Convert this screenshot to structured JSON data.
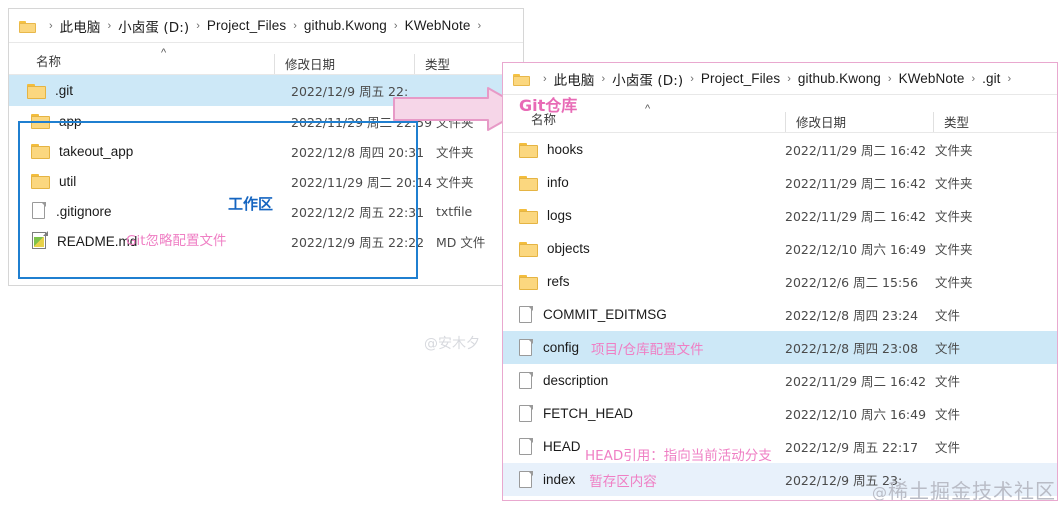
{
  "left_window": {
    "name": "working-directory-explorer",
    "breadcrumb": {
      "folder_icon": "folder-icon",
      "items": [
        "此电脑",
        "小卤蛋 (D:)",
        "Project_Files",
        "github.Kwong",
        "KWebNote"
      ],
      "separator": "›",
      "trailing_separator": "›"
    },
    "columns": [
      "名称",
      "修改日期",
      "类型"
    ],
    "sort_indicator": "^",
    "rows": [
      {
        "icon": "folder-icon",
        "name": ".git",
        "date": "2022/12/9 周五 22:",
        "type": "",
        "state": "selected"
      },
      {
        "icon": "folder-icon",
        "name": "app",
        "date": "2022/11/29 周二 22:59",
        "type": "文件夹",
        "state": "normal"
      },
      {
        "icon": "folder-icon",
        "name": "takeout_app",
        "date": "2022/12/8 周四 20:31",
        "type": "文件夹",
        "state": "normal"
      },
      {
        "icon": "folder-icon",
        "name": "util",
        "date": "2022/11/29 周二 20:14",
        "type": "文件夹",
        "state": "normal"
      },
      {
        "icon": "file-icon",
        "name": ".gitignore",
        "date": "2022/12/2 周五 22:31",
        "type": "txtfile",
        "state": "normal"
      },
      {
        "icon": "markdown-file-icon",
        "name": "README.md",
        "date": "2022/12/9 周五 22:22",
        "type": "MD 文件",
        "state": "normal"
      }
    ],
    "annotations": {
      "workspace": "工作区",
      "gitignore": "Git忽略配置文件"
    }
  },
  "right_window": {
    "name": "git-repository-explorer",
    "breadcrumb": {
      "folder_icon": "folder-icon",
      "items": [
        "此电脑",
        "小卤蛋 (D:)",
        "Project_Files",
        "github.Kwong",
        "KWebNote",
        ".git"
      ],
      "separator": "›",
      "trailing_separator": "›"
    },
    "columns": [
      "名称",
      "修改日期",
      "类型"
    ],
    "sort_indicator": "^",
    "title_annotation": "Git仓库",
    "rows": [
      {
        "icon": "folder-icon",
        "name": "hooks",
        "date": "2022/11/29 周二 16:42",
        "type": "文件夹",
        "state": "normal",
        "note": ""
      },
      {
        "icon": "folder-icon",
        "name": "info",
        "date": "2022/11/29 周二 16:42",
        "type": "文件夹",
        "state": "normal",
        "note": ""
      },
      {
        "icon": "folder-icon",
        "name": "logs",
        "date": "2022/11/29 周二 16:42",
        "type": "文件夹",
        "state": "normal",
        "note": ""
      },
      {
        "icon": "folder-icon",
        "name": "objects",
        "date": "2022/12/10 周六 16:49",
        "type": "文件夹",
        "state": "normal",
        "note": ""
      },
      {
        "icon": "folder-icon",
        "name": "refs",
        "date": "2022/12/6 周二 15:56",
        "type": "文件夹",
        "state": "normal",
        "note": ""
      },
      {
        "icon": "file-icon",
        "name": "COMMIT_EDITMSG",
        "date": "2022/12/8 周四 23:24",
        "type": "文件",
        "state": "normal",
        "note": ""
      },
      {
        "icon": "file-icon",
        "name": "config",
        "date": "2022/12/8 周四 23:08",
        "type": "文件",
        "state": "selected",
        "note": "项目/仓库配置文件"
      },
      {
        "icon": "file-icon",
        "name": "description",
        "date": "2022/11/29 周二 16:42",
        "type": "文件",
        "state": "normal",
        "note": ""
      },
      {
        "icon": "file-icon",
        "name": "FETCH_HEAD",
        "date": "2022/12/10 周六 16:49",
        "type": "文件",
        "state": "normal",
        "note": ""
      },
      {
        "icon": "file-icon",
        "name": "HEAD",
        "date": "2022/12/9 周五 22:17",
        "type": "文件",
        "state": "normal",
        "note": "HEAD引用：指向当前活动分支"
      },
      {
        "icon": "file-icon",
        "name": "index",
        "date": "2022/12/9 周五 23:",
        "type": "",
        "state": "selected2",
        "note": "暂存区内容"
      }
    ]
  },
  "arrow": {
    "name": "flow-arrow",
    "color": "#f0b8d8"
  },
  "watermarks": {
    "author": "@安木夕",
    "site_at": "@",
    "site": "稀土掘金技术社区"
  },
  "colors": {
    "selection": "#cde8f7",
    "selection_soft": "#e8f1fb",
    "workspace_box": "#1f7fd0",
    "annotation_pink": "#ef7fc4",
    "annotation_blue": "#1565c0",
    "panel_border_pink": "#e9a8cf",
    "folder_yellow": "#fbd77f"
  }
}
